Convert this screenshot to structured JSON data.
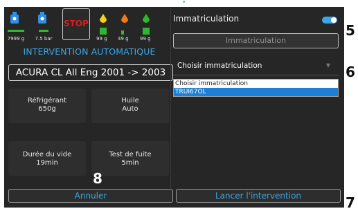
{
  "header": {
    "top_mark": "▾"
  },
  "gauges": {
    "g1": {
      "icon": "refrigerant-bottle-icon",
      "value": "7999 g"
    },
    "g2": {
      "icon": "pressure-bottle-icon",
      "value": "7.5 bar"
    },
    "stop": "STOP",
    "d1": {
      "icon": "yellow-drop-icon",
      "value": "99 g"
    },
    "d2": {
      "icon": "orange-drop-icon",
      "value": "49 g"
    },
    "d3": {
      "icon": "green-drop-icon",
      "value": "99 g"
    }
  },
  "intervention": {
    "title": "INTERVENTION AUTOMATIQUE",
    "vehicle": "ACURA CL All Eng 2001 -> 2003"
  },
  "params": {
    "refrigerant": {
      "label": "Réfrigérant",
      "value": "650g"
    },
    "oil": {
      "label": "Huile",
      "value": "Auto"
    },
    "vacuum": {
      "label": "Durée du vide",
      "value": "19min"
    },
    "leak": {
      "label": "Test de fuite",
      "value": "5min"
    }
  },
  "buttons": {
    "cancel": "Annuler",
    "launch": "Lancer l'intervention"
  },
  "registration": {
    "title": "Immatriculation",
    "input_placeholder": "Immatriculation",
    "select_value": "Choisir immatriculation",
    "options": [
      "Choisir immatriculation",
      "TRUI67OL"
    ]
  },
  "callouts": {
    "c5": "5",
    "c6": "6",
    "c7": "7",
    "c8": "8"
  },
  "colors": {
    "accent": "#3aa7e6",
    "stop": "#e21b1b",
    "gauge_green": "#2eb82e",
    "background": "#262626"
  }
}
